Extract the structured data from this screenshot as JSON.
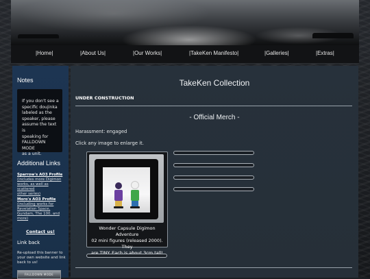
{
  "nav": {
    "items": [
      "|Home|",
      "|About Us|",
      "|Our Works|",
      "|TakeKen Manifesto|",
      "|Galleries|",
      "|Extras|"
    ]
  },
  "sidebar": {
    "notes_heading": "Notes",
    "notes_lines": [
      "If you don't see a",
      "specific doujinka",
      "labeled as the",
      "speaker, please",
      "assume the text is",
      "speaking for",
      "FALLDOWN MODE",
      "as a unit."
    ],
    "links_heading": "Additional Links",
    "links": [
      {
        "title": "Sparrow's AO3 Profile",
        "desc_lines": [
          "(includes more Digimon",
          "works, as well as scattered",
          "other series)"
        ]
      },
      {
        "title": "Moro's AO3 Profile",
        "desc_lines": [
          "(including works for",
          "Revelation Space,",
          "Gundam, The 100, and",
          "more)"
        ]
      }
    ],
    "contact": "Contact us!",
    "linkback_heading": "Link back",
    "linkback_lines": [
      "Re-upload this banner to",
      "your own website and link",
      "back to us!"
    ],
    "linkback_banner": "FALLDOWN MODE"
  },
  "main": {
    "title": "TakeKen Collection",
    "under_construction": "UNDER CONSTRUCTION",
    "section_title": "- Official Merch -",
    "harassment": "Harassment: engaged",
    "click_hint": "Click any image to enlarge it.",
    "item_caption_lines": [
      "Wonder Capsule Digimon Adventure",
      "02 mini figures (released 2000). They",
      "are TINY. Each is about 3cm tall!"
    ]
  },
  "colors": {
    "sidebar_bg": "#1d3552",
    "main_bg": "#27313b",
    "nav_bg": "#121315",
    "text": "#e6e8ea"
  }
}
